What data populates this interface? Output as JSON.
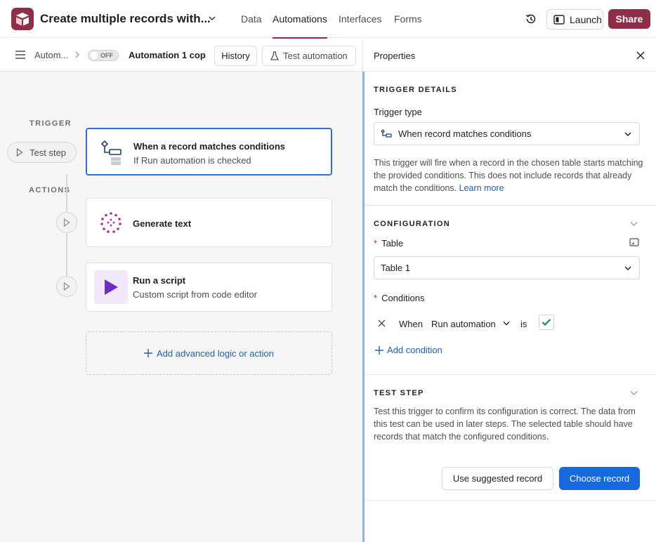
{
  "header": {
    "base_title": "Create multiple records with...",
    "tabs": [
      {
        "label": "Data"
      },
      {
        "label": "Automations"
      },
      {
        "label": "Interfaces"
      },
      {
        "label": "Forms"
      }
    ],
    "launch_label": "Launch",
    "share_label": "Share",
    "colors": {
      "brand": "#8f2f47",
      "accent": "#1769e0"
    }
  },
  "toolbar": {
    "breadcrumb": "Autom...",
    "toggle_label": "OFF",
    "automation_name": "Automation 1 cop",
    "history_label": "History",
    "test_automation_label": "Test automation"
  },
  "canvas": {
    "trigger_label": "TRIGGER",
    "actions_label": "ACTIONS",
    "test_step_label": "Test step",
    "trigger_card": {
      "title": "When a record matches conditions",
      "subtitle": "If Run automation is checked",
      "icon": "conditions-icon"
    },
    "actions": [
      {
        "title": "Generate text",
        "subtitle": "",
        "icon": "ai-sparkle-icon"
      },
      {
        "title": "Run a script",
        "subtitle": "Custom script from code editor",
        "icon": "script-play-icon"
      }
    ],
    "add_label": "Add advanced logic or action"
  },
  "properties": {
    "title": "Properties",
    "trigger_details": {
      "heading": "TRIGGER DETAILS",
      "trigger_type_label": "Trigger type",
      "trigger_type_value": "When record matches conditions",
      "description": "This trigger will fire when a record in the chosen table starts matching the provided conditions. This does not include records that already match the conditions.",
      "learn_more": "Learn more"
    },
    "configuration": {
      "heading": "CONFIGURATION",
      "table_label": "Table",
      "table_value": "Table 1",
      "conditions_label": "Conditions",
      "condition": {
        "when": "When",
        "field": "Run automation",
        "operator": "is",
        "checked": true
      },
      "add_condition": "Add condition"
    },
    "test_step": {
      "heading": "TEST STEP",
      "description": "Test this trigger to confirm its configuration is correct. The data from this test can be used in later steps. The selected table should have records that match the configured conditions.",
      "use_suggested": "Use suggested record",
      "choose_record": "Choose record"
    }
  }
}
